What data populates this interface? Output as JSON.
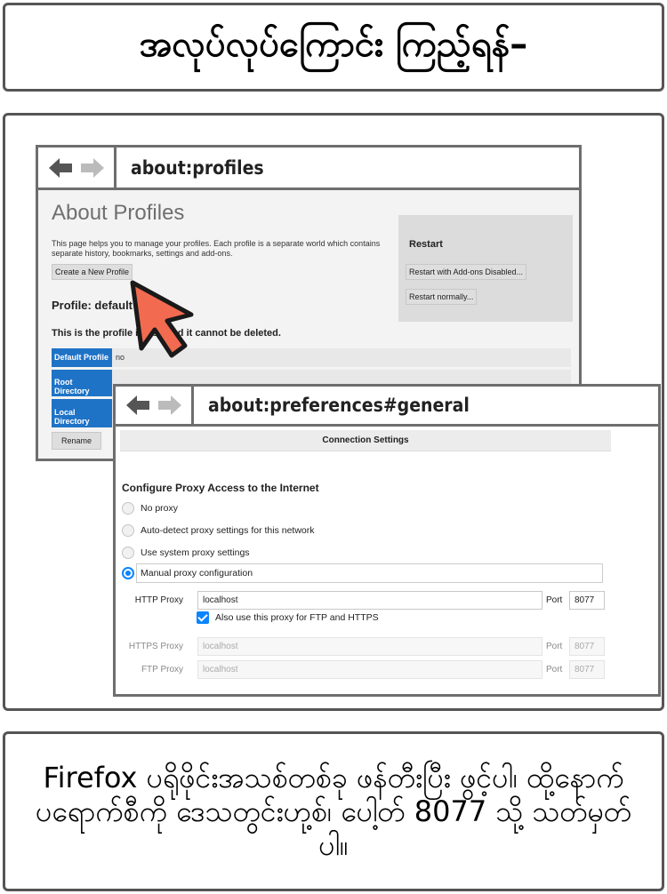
{
  "header": {
    "title": "အလုပ်လုပ်ကြောင်း ကြည့်ရန်–"
  },
  "profiles_window": {
    "url": "about:profiles",
    "heading": "About Profiles",
    "description": "This page helps you to manage your profiles. Each profile is a separate world which contains separate history, bookmarks, settings and add-ons.",
    "create_button": "Create a New Profile",
    "profile_title": "Profile: default",
    "note": "This is the profile in use and it cannot be deleted.",
    "restart": {
      "title": "Restart",
      "addons_disabled_button": "Restart with Add-ons Disabled...",
      "normal_button": "Restart normally..."
    },
    "table": [
      {
        "key": "Default Profile",
        "value": "no"
      },
      {
        "key": "Root Directory",
        "value": ""
      },
      {
        "key": "Local Directory",
        "value": ""
      }
    ],
    "rename_button": "Rename"
  },
  "preferences_window": {
    "url": "about:preferences#general",
    "dialog_title": "Connection Settings",
    "section_title": "Configure Proxy Access to the Internet",
    "options": [
      {
        "label": "No proxy",
        "selected": false
      },
      {
        "label": "Auto-detect proxy settings for this network",
        "selected": false
      },
      {
        "label": "Use system proxy settings",
        "selected": false
      },
      {
        "label": "Manual proxy configuration",
        "selected": true
      }
    ],
    "http_proxy": {
      "label": "HTTP Proxy",
      "value": "localhost",
      "port_label": "Port",
      "port": "8077"
    },
    "also_use": {
      "label": "Also use this proxy for FTP and HTTPS",
      "checked": true
    },
    "https_proxy": {
      "label": "HTTPS Proxy",
      "value": "localhost",
      "port_label": "Port",
      "port": "8077"
    },
    "ftp_proxy": {
      "label": "FTP Proxy",
      "value": "localhost",
      "port_label": "Port",
      "port": "8077"
    }
  },
  "caption": "Firefox ပရိုဖိုင်းအသစ်တစ်ခု ဖန်တီးပြီး ဖွင့်ပါ၊ ထို့နောက် ပရောက်စီကို ဒေသတွင်းဟု့စ်၊ ပေါ့တ် 8077 သို့ သတ်မှတ်ပါ။",
  "colors": {
    "accent": "#0a84ff",
    "table_key_bg": "#1f73c6",
    "cursor": "#f26b50"
  },
  "icons": [
    "back-arrow-icon",
    "forward-arrow-icon",
    "mouse-pointer-icon"
  ]
}
